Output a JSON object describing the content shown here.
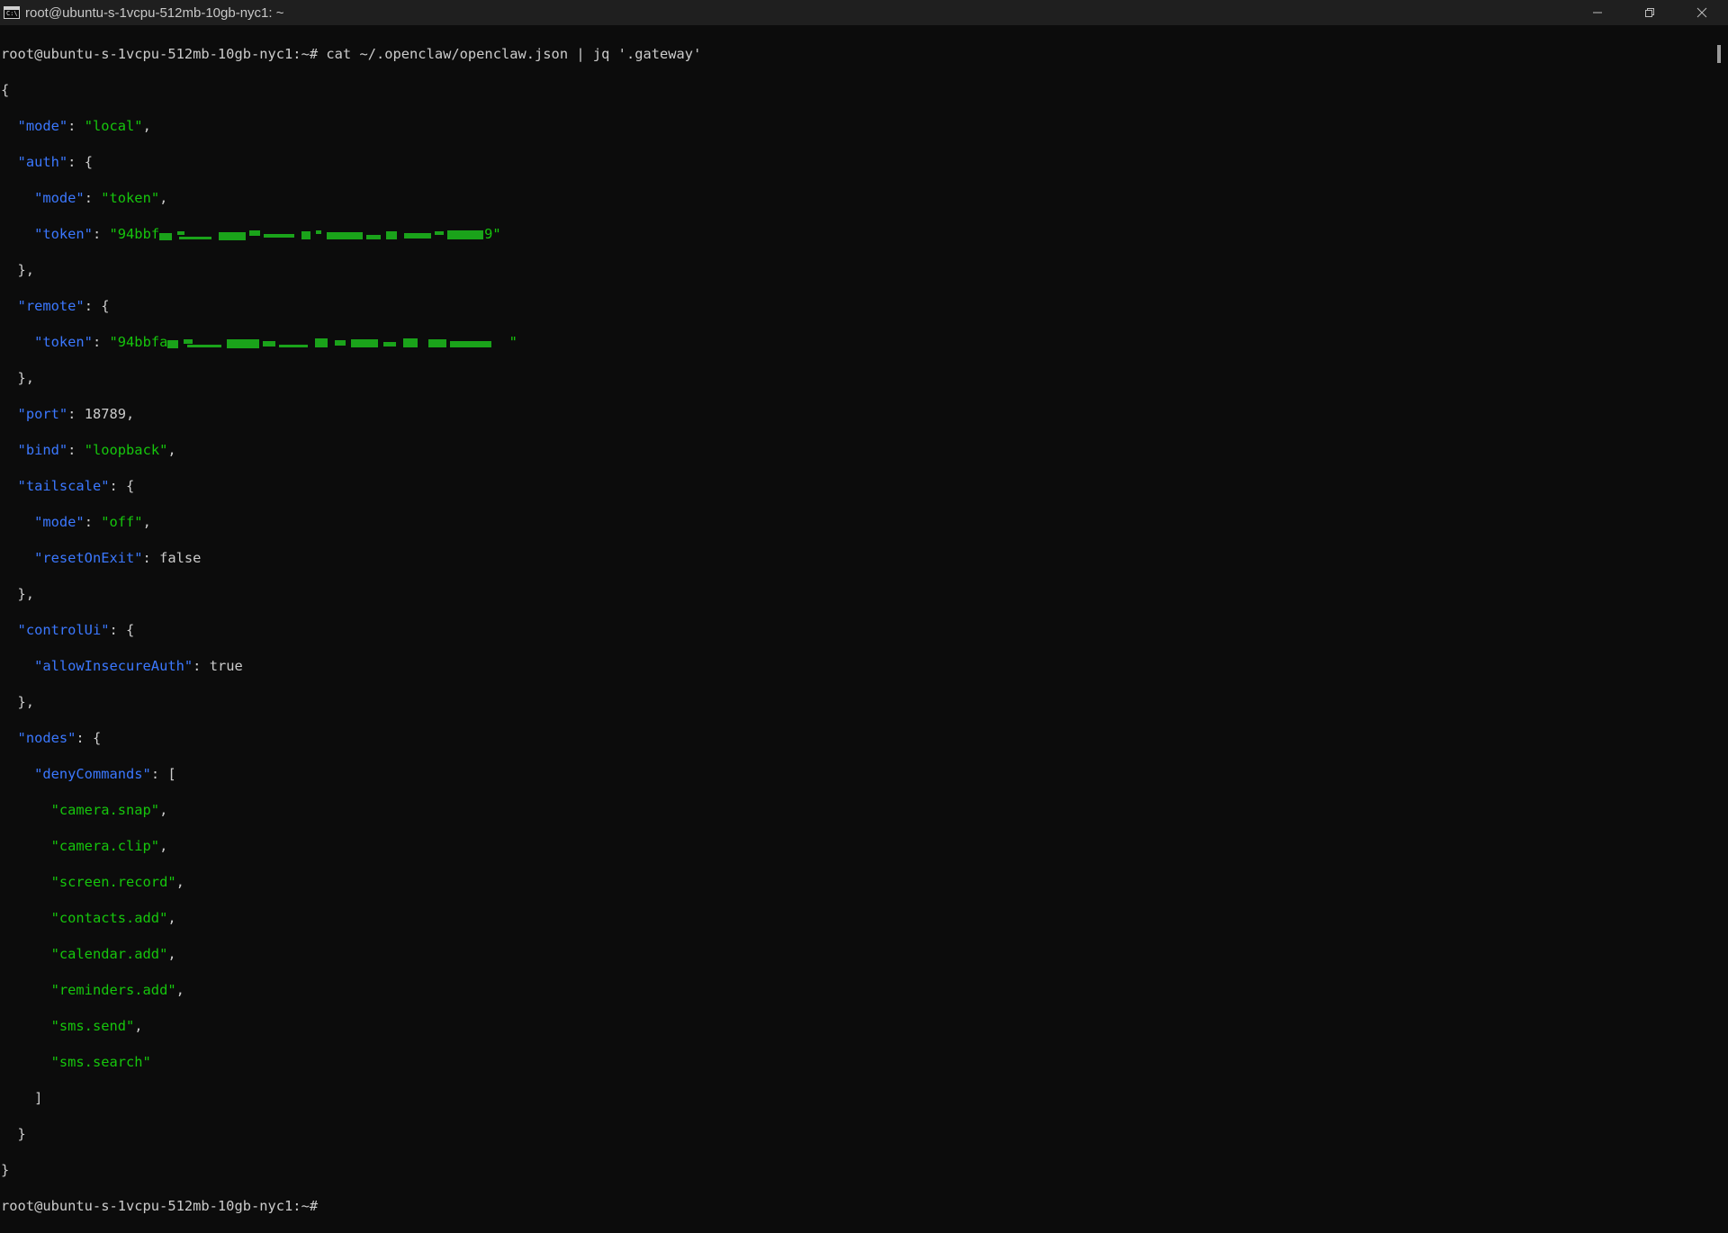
{
  "window": {
    "title": "root@ubuntu-s-1vcpu-512mb-10gb-nyc1: ~",
    "icon": "terminal-icon",
    "icon_text": "C:\\",
    "controls": {
      "minimize": "─",
      "restore": "❐",
      "close": "✕"
    }
  },
  "terminal": {
    "prompt": "root@ubuntu-s-1vcpu-512mb-10gb-nyc1:~# ",
    "command": "cat ~/.openclaw/openclaw.json | jq '.gateway'",
    "end_prompt": "root@ubuntu-s-1vcpu-512mb-10gb-nyc1:~#",
    "colors": {
      "key": "#3b78ff",
      "string": "#16c60c",
      "text": "#cccccc",
      "background": "#0c0c0c"
    },
    "json": {
      "open_brace": "{",
      "mode_key": "\"mode\"",
      "mode_val": "\"local\"",
      "auth_key": "\"auth\"",
      "auth_mode_key": "\"mode\"",
      "auth_mode_val": "\"token\"",
      "auth_token_key": "\"token\"",
      "auth_token_prefix": "\"94bbf",
      "auth_token_suffix": "9\"",
      "remote_key": "\"remote\"",
      "remote_token_key": "\"token\"",
      "remote_token_prefix": "\"94bbfa",
      "remote_token_suffix": " \"",
      "port_key": "\"port\"",
      "port_val": "18789",
      "bind_key": "\"bind\"",
      "bind_val": "\"loopback\"",
      "tailscale_key": "\"tailscale\"",
      "ts_mode_key": "\"mode\"",
      "ts_mode_val": "\"off\"",
      "ts_reset_key": "\"resetOnExit\"",
      "ts_reset_val": "false",
      "controlui_key": "\"controlUi\"",
      "allow_key": "\"allowInsecureAuth\"",
      "allow_val": "true",
      "nodes_key": "\"nodes\"",
      "deny_key": "\"denyCommands\"",
      "deny_commands": [
        "\"camera.snap\"",
        "\"camera.clip\"",
        "\"screen.record\"",
        "\"contacts.add\"",
        "\"calendar.add\"",
        "\"reminders.add\"",
        "\"sms.send\"",
        "\"sms.search\""
      ],
      "close_brace": "}"
    }
  }
}
